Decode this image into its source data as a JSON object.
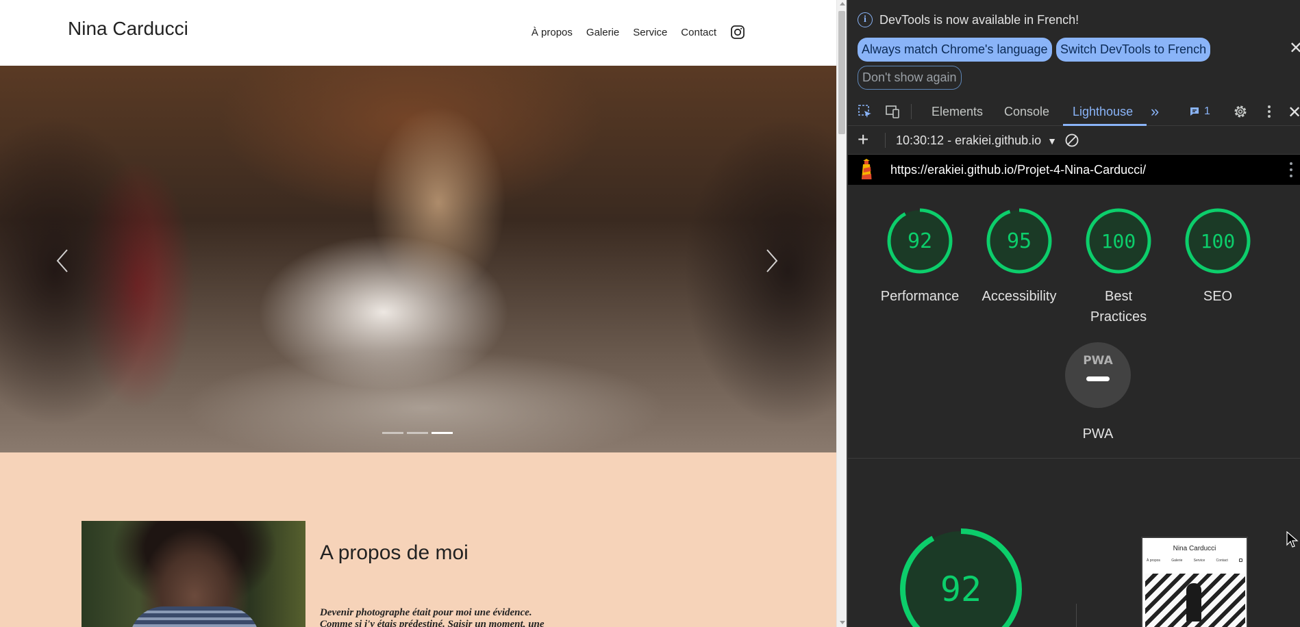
{
  "site": {
    "title": "Nina Carducci",
    "nav": [
      "À propos",
      "Galerie",
      "Service",
      "Contact"
    ],
    "instagram_icon": "instagram-icon",
    "carousel": {
      "slide_count": 3,
      "active_index": 2
    },
    "about": {
      "title": "A propos de moi",
      "text_line1": "Devenir photographe était pour moi une évidence.",
      "text_line2": "Comme si j'y étais prédestiné. Saisir un moment, une"
    },
    "colors": {
      "about_bg": "#f6d3b9"
    }
  },
  "devtools": {
    "infobar": {
      "message": "DevTools is now available in French!",
      "buttons": {
        "match": "Always match Chrome's language",
        "switch": "Switch DevTools to French",
        "dont_show": "Don't show again"
      }
    },
    "tabs": [
      "Elements",
      "Console",
      "Lighthouse"
    ],
    "active_tab": "Lighthouse",
    "issues_count": "1",
    "lighthouse": {
      "report_select": "10:30:12 - erakiei.github.io",
      "url": "https://erakiei.github.io/Projet-4-Nina-Carducci/",
      "scores": [
        {
          "label": "Performance",
          "value": "92"
        },
        {
          "label": "Accessibility",
          "value": "95"
        },
        {
          "label": "Best Practices",
          "value": "100"
        },
        {
          "label": "SEO",
          "value": "100"
        }
      ],
      "pwa": {
        "label": "PWA",
        "badge": "PWA"
      },
      "main_score": "92",
      "thumbnail": {
        "title": "Nina Carducci",
        "nav": [
          "À propos",
          "Galerie",
          "Service",
          "Contact"
        ]
      }
    },
    "colors": {
      "pass": "#0cce6b",
      "accent": "#8ab4f8",
      "panel_bg": "#282828"
    }
  }
}
